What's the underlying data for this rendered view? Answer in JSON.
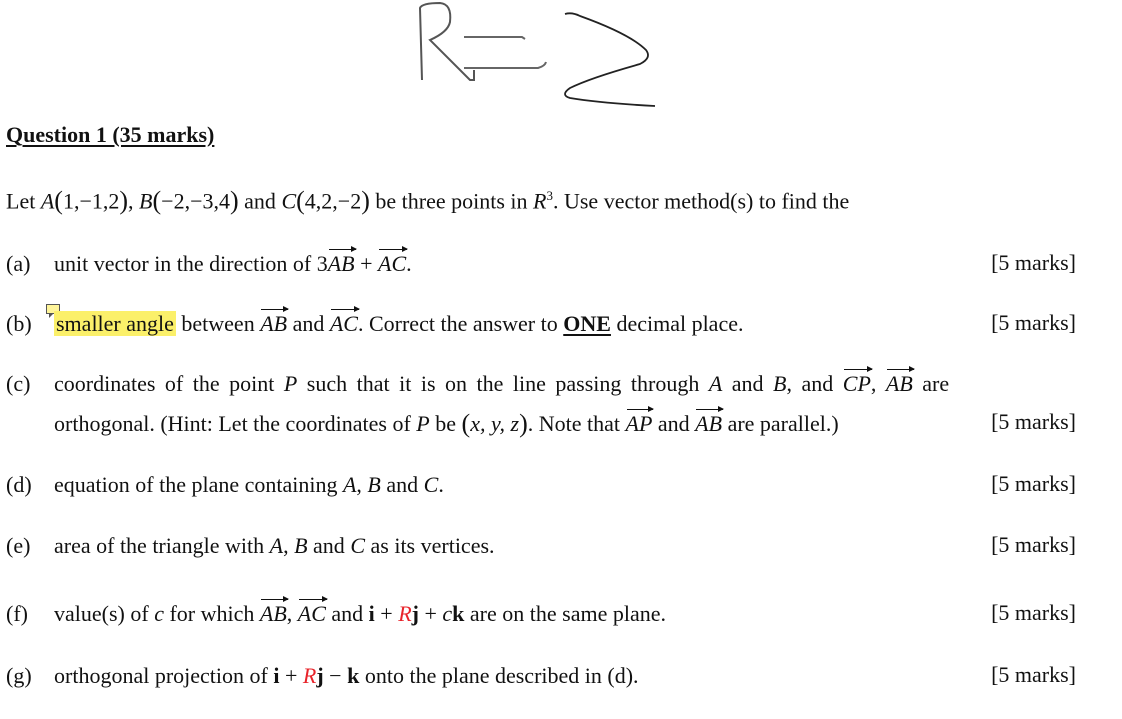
{
  "handwriting": {
    "text": "R=2"
  },
  "question": {
    "title": "Question 1 (35 marks)",
    "intro": {
      "let": "Let",
      "pointA": "A",
      "coordsA": "1,−1,2",
      "pointB": "B",
      "coordsB": "−2,−3,4",
      "and": "and",
      "pointC": "C",
      "coordsC": "4,2,−2",
      "text1": "be three points in",
      "space": "R",
      "space_exp": "3",
      "text2": ". Use vector method(s) to find the"
    },
    "parts": [
      {
        "label": "(a)",
        "text1": "unit vector in the direction of 3",
        "v1": "AB",
        "plus": " + ",
        "v2": "AC",
        "end": ".",
        "marks": "[5 marks]"
      },
      {
        "label": "(b)",
        "highlight": "smaller angle",
        "text1": " between ",
        "v1": "AB",
        "and": " and ",
        "v2": "AC",
        "text2": ". Correct the answer to ",
        "emph": "ONE",
        "text3": " decimal place.",
        "marks": "[5 marks]"
      },
      {
        "label": "(c)",
        "line1_text1": "coordinates of the point ",
        "P": "P",
        "line1_text2": " such that it is on the line passing through ",
        "A": "A",
        "and": " and ",
        "B": "B",
        "line1_text3": ", and ",
        "v1": "CP",
        "comma": ", ",
        "v2": "AB",
        "line1_text4": " are",
        "line2_text1": "orthogonal. (Hint: Let the coordinates of ",
        "P2": "P",
        "line2_text2": " be ",
        "xyz": "x, y, z",
        "line2_text3": ". Note that ",
        "v3": "AP",
        "and2": " and ",
        "v4": "AB",
        "line2_text4": " are parallel.) ",
        "marks": "[5 marks]"
      },
      {
        "label": "(d)",
        "text1": "equation of the plane containing ",
        "A": "A",
        "sep": ", ",
        "B": "B",
        "and": " and ",
        "C": "C",
        "end": ".",
        "marks": "[5 marks]"
      },
      {
        "label": "(e)",
        "text1": "area of the triangle with ",
        "A": "A",
        "sep": ", ",
        "B": "B",
        "and": " and ",
        "C": "C",
        "text2": " as its vertices.",
        "marks": "[5 marks]"
      },
      {
        "label": "(f)",
        "text1": "value(s) of ",
        "c": "c",
        "text2": " for which ",
        "v1": "AB",
        "comma": ", ",
        "v2": "AC",
        "and": " and ",
        "i": "i",
        "plus1": " + ",
        "R": "R",
        "j": "j",
        "plus2": " + ",
        "c2": "c",
        "k": "k",
        "text3": " are on the same plane.",
        "marks": "[5 marks]"
      },
      {
        "label": "(g)",
        "text1": "orthogonal projection of ",
        "i": "i",
        "plus": " + ",
        "R": "R",
        "j": "j",
        "minus": " − ",
        "k": "k",
        "text2": " onto the plane described in (d).",
        "marks": "[5 marks]"
      }
    ]
  },
  "colors": {
    "highlight": "#fbf06a",
    "parameter_red": "#e8232a",
    "text": "#111111"
  }
}
